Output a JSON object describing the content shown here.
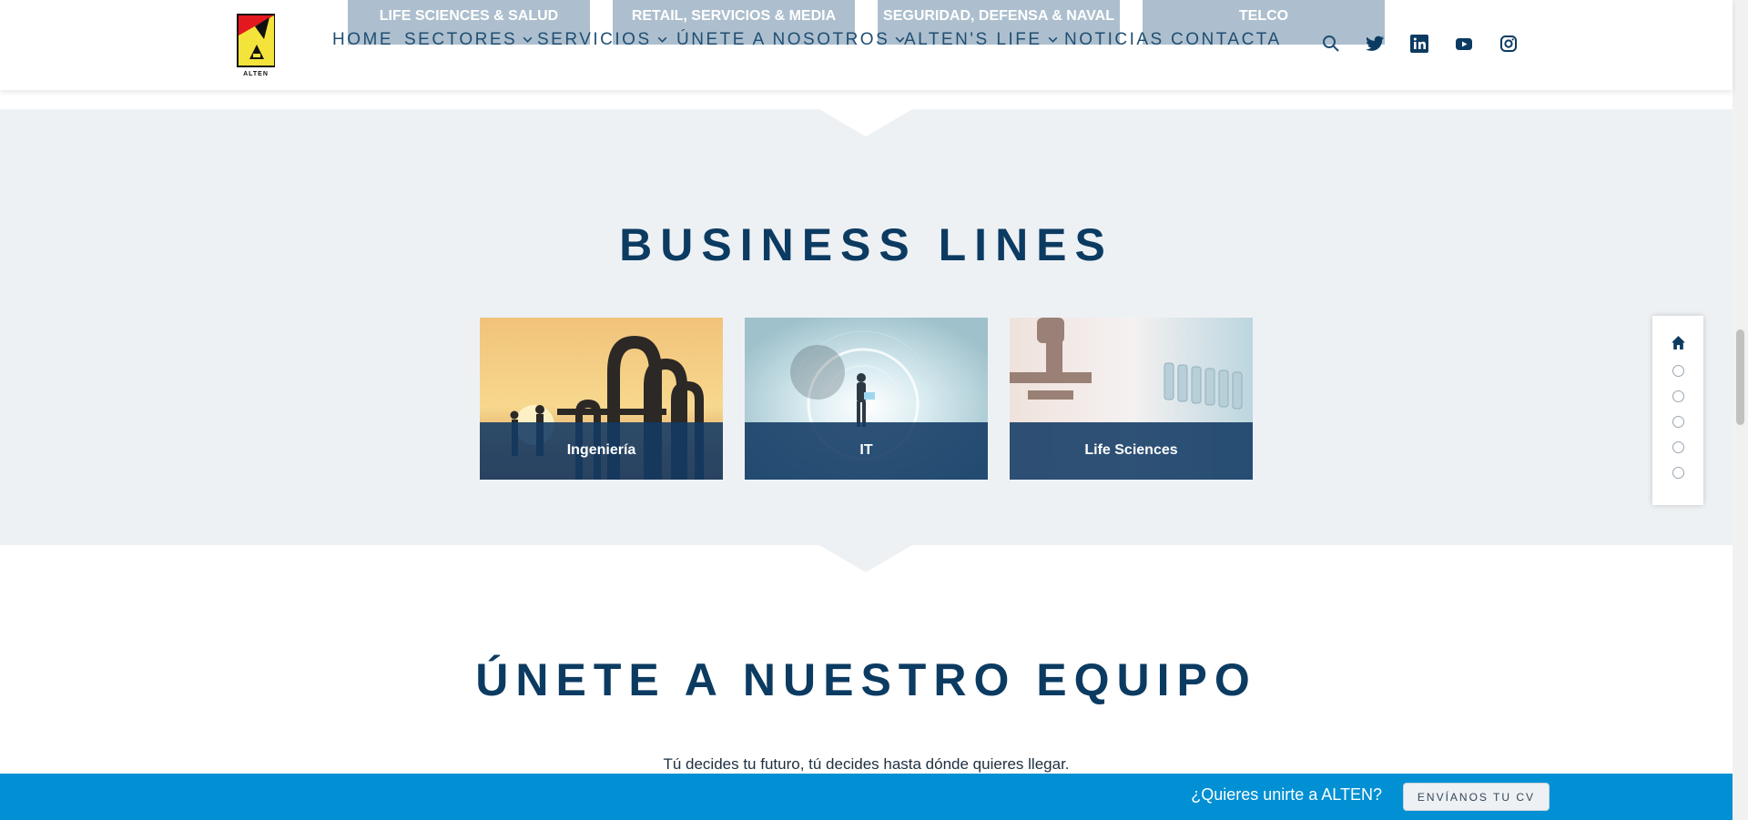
{
  "header": {
    "sector_tiles": [
      "LIFE SCIENCES & SALUD",
      "RETAIL, SERVICIOS & MEDIA",
      "SEGURIDAD, DEFENSA & NAVAL",
      "TELCO"
    ],
    "logo_text": "ALTEN",
    "nav": [
      {
        "label": "HOME",
        "dropdown": false
      },
      {
        "label": "SECTORES",
        "dropdown": true
      },
      {
        "label": "SERVICIOS",
        "dropdown": true
      },
      {
        "label": "ÚNETE A NOSOTROS",
        "dropdown": true
      },
      {
        "label": "ALTEN'S LIFE",
        "dropdown": true
      },
      {
        "label": "NOTICIAS",
        "dropdown": false
      },
      {
        "label": "CONTACTA",
        "dropdown": false
      }
    ],
    "tools": [
      "search-icon",
      "twitter-icon",
      "linkedin-icon",
      "youtube-icon",
      "instagram-icon"
    ]
  },
  "business_lines": {
    "title": "BUSINESS LINES",
    "cards": [
      {
        "label": "Ingeniería",
        "image": "industrial pipes at sunset"
      },
      {
        "label": "IT",
        "image": "woman with laptop digital"
      },
      {
        "label": "Life Sciences",
        "image": "laboratory microscope"
      }
    ]
  },
  "join": {
    "title": "ÚNETE A NUESTRO EQUIPO",
    "subtitle": "Tú decides tu futuro, tú decides hasta dónde quieres llegar."
  },
  "cv_bar": {
    "question": "¿Quieres unirte a ALTEN?",
    "button": "ENVÍANOS TU CV"
  },
  "colors": {
    "brand_navy": "#0c3b62",
    "nav_text": "#1f4e72",
    "section_bg": "#eef1f4",
    "cv_bar": "#0090d3"
  }
}
